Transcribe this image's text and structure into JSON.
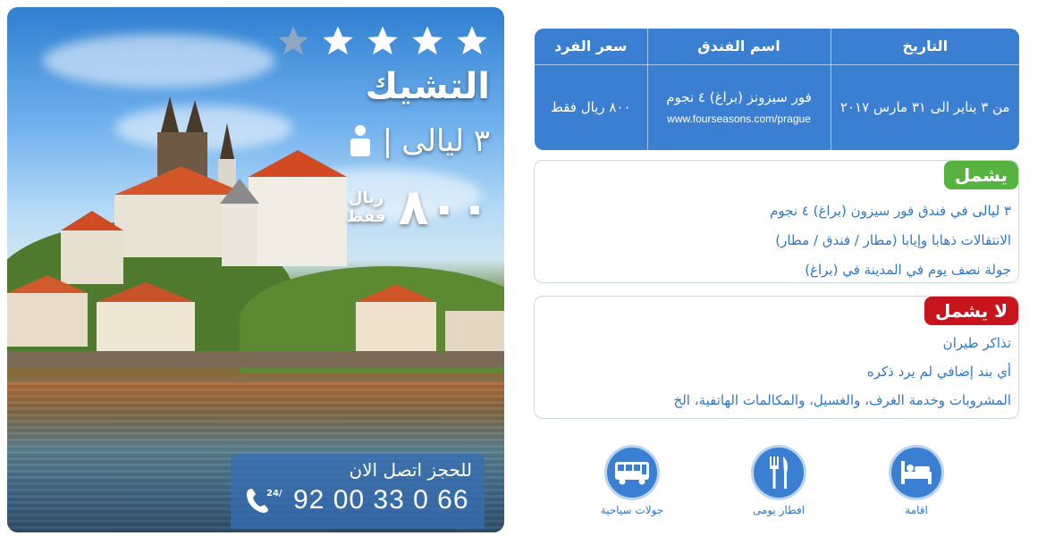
{
  "package": {
    "stars_filled": 4,
    "stars_total": 5,
    "destination": "التشيك",
    "nights": "٣ ليالى",
    "price": "٨٠٠",
    "currency_line1": "ريال",
    "currency_line2": "فقط",
    "contact_label": "للحجز اتصل الان",
    "contact_phone": "92 00 33 0 66",
    "phone_badge": "24/7"
  },
  "table": {
    "headers": [
      "التاريخ",
      "اسم الفندق",
      "سعر الفرد"
    ],
    "date": "من ٣ يناير الى ٣١ مارس ٢٠١٧",
    "hotel_name": "فور سيزونز (براغ) ٤ نجوم",
    "hotel_url": "www.fourseasons.com/prague",
    "price": "٨٠٠ ريال فقط"
  },
  "includes": {
    "badge": "يشمل",
    "items": [
      "٣ ليالى في فندق فور سيزون (براغ) ٤ نجوم",
      "الانتقالات ذهابا وإيابا (مطار / فندق / مطار)",
      "جولة نصف يوم في المدينة في (براغ)"
    ]
  },
  "excludes": {
    "badge": "لا يشمل",
    "items": [
      "تذاكر طيران",
      "أي بند إضافي لم يرد ذكره",
      "المشروبات وخدمة الغرف، والغسيل، والمكالمات الهاتفية، الخ"
    ]
  },
  "features": [
    {
      "label": "اقامة",
      "icon": "bed-icon"
    },
    {
      "label": "افطار يومى",
      "icon": "fork-knife-icon"
    },
    {
      "label": "جولات سياحية",
      "icon": "bus-icon"
    }
  ],
  "colors": {
    "primary_blue": "#3a7fd2",
    "text_blue": "#2e78c9",
    "green_badge": "#56b33f",
    "red_badge": "#c8141c"
  }
}
